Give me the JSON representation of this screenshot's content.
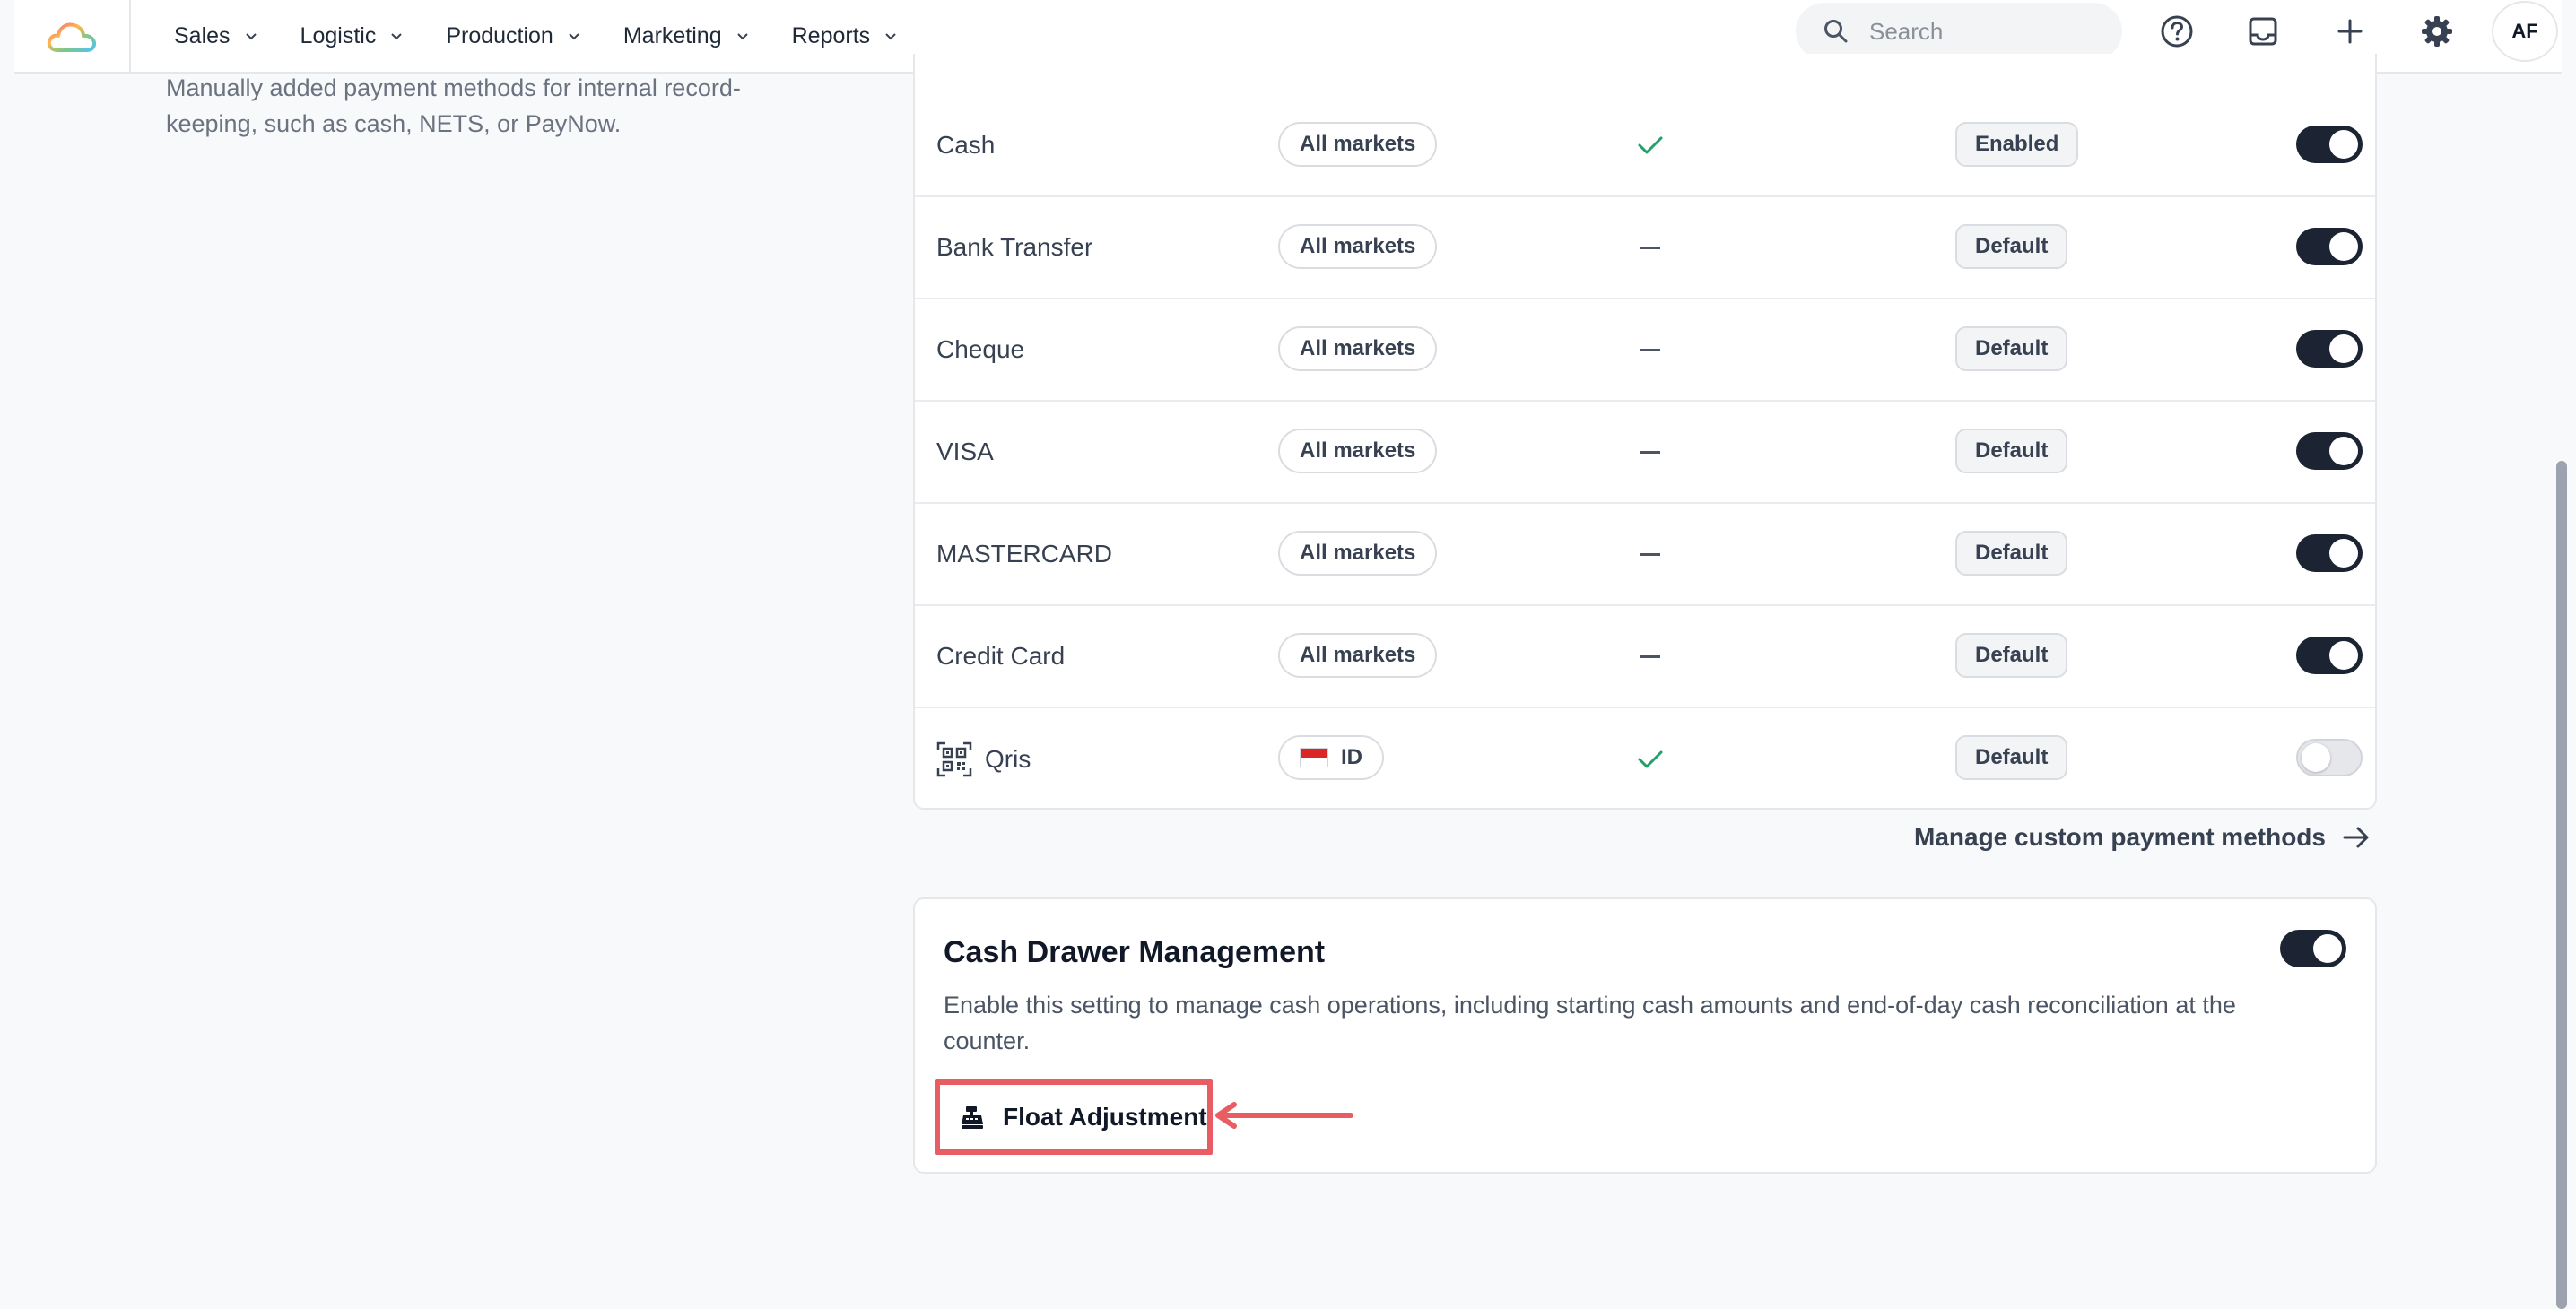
{
  "nav": {
    "items": [
      {
        "label": "Sales"
      },
      {
        "label": "Logistic"
      },
      {
        "label": "Production"
      },
      {
        "label": "Marketing"
      },
      {
        "label": "Reports"
      }
    ],
    "search_placeholder": "Search",
    "avatar_initials": "AF"
  },
  "section": {
    "description": "Manually added payment methods for internal record-keeping, such as cash, NETS, or PayNow."
  },
  "payment_methods": [
    {
      "name": "Cash",
      "market": "All markets",
      "mark": "check",
      "status": "Enabled",
      "enabled": true
    },
    {
      "name": "Bank Transfer",
      "market": "All markets",
      "mark": "dash",
      "status": "Default",
      "enabled": true
    },
    {
      "name": "Cheque",
      "market": "All markets",
      "mark": "dash",
      "status": "Default",
      "enabled": true
    },
    {
      "name": "VISA",
      "market": "All markets",
      "mark": "dash",
      "status": "Default",
      "enabled": true
    },
    {
      "name": "MASTERCARD",
      "market": "All markets",
      "mark": "dash",
      "status": "Default",
      "enabled": true
    },
    {
      "name": "Credit Card",
      "market": "All markets",
      "mark": "dash",
      "status": "Default",
      "enabled": true
    },
    {
      "name": "Qris",
      "market": "ID",
      "mark": "check",
      "status": "Default",
      "enabled": false,
      "icon": "qr-code-icon"
    }
  ],
  "manage_link": "Manage custom payment methods",
  "cash_drawer": {
    "title": "Cash Drawer Management",
    "description": "Enable this setting to manage cash operations, including starting cash amounts and end-of-day cash reconciliation at the counter.",
    "enabled": true,
    "float_button": "Float Adjustment"
  },
  "colors": {
    "toggle_on": "#1c2434",
    "check": "#22a06b",
    "annotation": "#e85d63"
  }
}
